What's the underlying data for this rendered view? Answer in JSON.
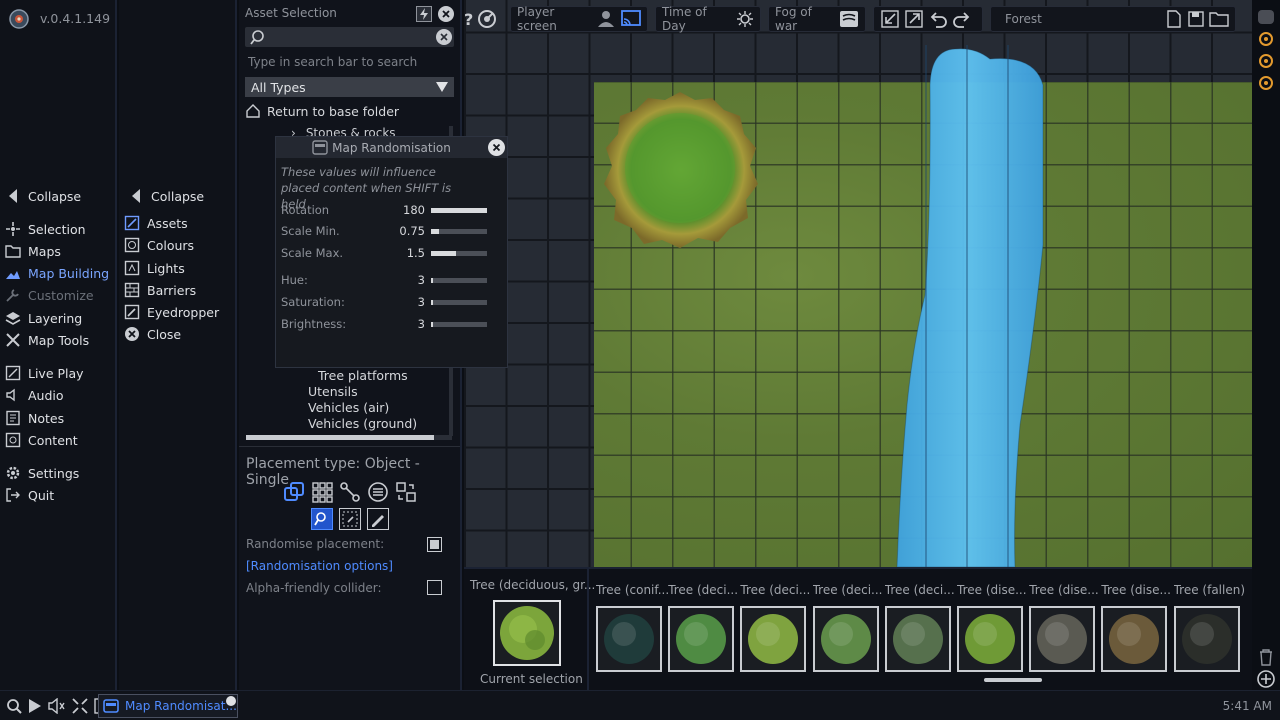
{
  "app": {
    "version": "v.0.4.1.149"
  },
  "nav_primary": {
    "collapse": "Collapse",
    "items": [
      {
        "label": "Selection",
        "icon": "cursor-icon"
      },
      {
        "label": "Maps",
        "icon": "folder-icon"
      },
      {
        "label": "Map Building",
        "icon": "map-building-icon",
        "active": true
      },
      {
        "label": "Customize",
        "icon": "wrench-icon",
        "disabled": true
      },
      {
        "label": "Layering",
        "icon": "layers-icon"
      },
      {
        "label": "Map Tools",
        "icon": "tools-icon"
      },
      {
        "label": "Live Play",
        "icon": "live-play-icon"
      },
      {
        "label": "Audio",
        "icon": "speaker-icon"
      },
      {
        "label": "Notes",
        "icon": "note-icon"
      },
      {
        "label": "Content",
        "icon": "content-icon"
      },
      {
        "label": "Settings",
        "icon": "gear-icon"
      },
      {
        "label": "Quit",
        "icon": "exit-icon"
      }
    ]
  },
  "nav_secondary": {
    "collapse": "Collapse",
    "items": [
      {
        "label": "Assets",
        "icon": "assets-icon"
      },
      {
        "label": "Colours",
        "icon": "palette-icon"
      },
      {
        "label": "Lights",
        "icon": "light-icon"
      },
      {
        "label": "Barriers",
        "icon": "barrier-icon"
      },
      {
        "label": "Eyedropper",
        "icon": "eyedropper-icon"
      },
      {
        "label": "Close",
        "icon": "close-circle-icon"
      }
    ]
  },
  "asset_panel": {
    "title": "Asset Selection",
    "search_hint": "Type in search bar to search",
    "type_select": "All Types",
    "return_label": "Return to base folder",
    "folder_partial": "Stones & rocks",
    "folders": [
      "Tree platforms",
      "Utensils",
      "Vehicles (air)",
      "Vehicles (ground)"
    ],
    "placement_type": "Placement type: Object - Single",
    "randomise_label": "Randomise placement:",
    "randomise_options": "[Randomisation options]",
    "alpha_label": "Alpha-friendly collider:"
  },
  "rand_dialog": {
    "title": "Map Randomisation",
    "note": "These values will influence placed content when SHIFT is held",
    "rows": [
      {
        "label": "Rotation",
        "value": "180",
        "fill": 1.0
      },
      {
        "label": "Scale Min.",
        "value": "0.75",
        "fill": 0.15
      },
      {
        "label": "Scale Max.",
        "value": "1.5",
        "fill": 0.45
      },
      {
        "label": "Hue:",
        "value": "3",
        "fill": 0.03
      },
      {
        "label": "Saturation:",
        "value": "3",
        "fill": 0.03
      },
      {
        "label": "Brightness:",
        "value": "3",
        "fill": 0.03
      }
    ]
  },
  "toolbar": {
    "player_screen": "Player screen",
    "time_of_day": "Time of Day",
    "fog_of_war": "Fog of war",
    "map_name": "Forest"
  },
  "strip": {
    "current_label": "Tree (deciduous, gr...",
    "current_caption": "Current selection",
    "items": [
      {
        "label": "Tree (conif...",
        "color": "#1f3b3a"
      },
      {
        "label": "Tree (deci...",
        "color": "#4f8b43"
      },
      {
        "label": "Tree (deci...",
        "color": "#7fa33f"
      },
      {
        "label": "Tree (deci...",
        "color": "#5e8a47"
      },
      {
        "label": "Tree (deci...",
        "color": "#56704d"
      },
      {
        "label": "Tree (dise...",
        "color": "#6f9a36"
      },
      {
        "label": "Tree (dise...",
        "color": "#5a5a52"
      },
      {
        "label": "Tree (dise...",
        "color": "#6b5a3a"
      },
      {
        "label": "Tree (fallen)",
        "color": "#2b2e2a"
      }
    ]
  },
  "taskbar": {
    "window_label": "Map Randomisat...",
    "clock": "5:41 AM"
  }
}
